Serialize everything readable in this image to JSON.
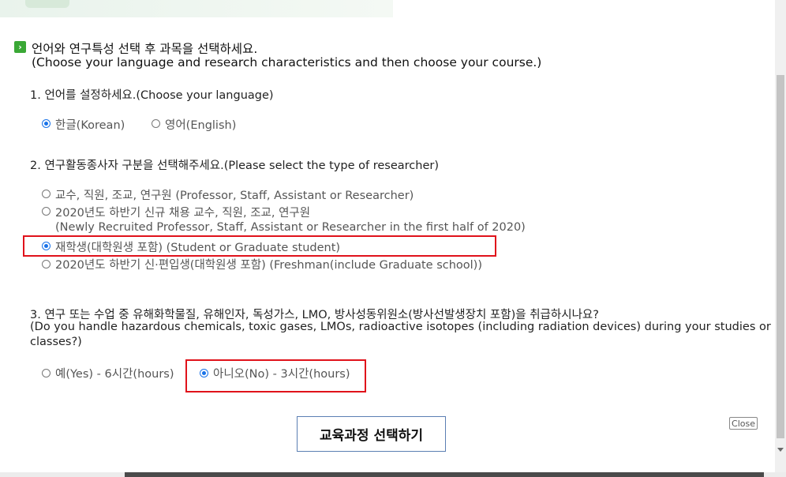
{
  "header": {
    "icon_glyph": "›",
    "line1": "언어와 연구특성 선택 후 과목을 선택하세요.",
    "line2": "(Choose your language and research characteristics and then choose your course.)"
  },
  "language": {
    "question": "1. 언어를 설정하세요.(Choose your language)",
    "options": [
      {
        "label": "한글(Korean)",
        "selected": true
      },
      {
        "label": "영어(English)",
        "selected": false
      }
    ]
  },
  "researcher": {
    "question": "2. 연구활동종사자 구분을 선택해주세요.(Please select the type of researcher)",
    "options": [
      {
        "label": "교수, 직원, 조교, 연구원 (Professor, Staff, Assistant or Researcher)",
        "selected": false
      },
      {
        "label": "2020년도 하반기 신규 채용 교수, 직원, 조교, 연구원",
        "label2": "(Newly Recruited Professor, Staff, Assistant or Researcher in the first half of 2020)",
        "selected": false
      },
      {
        "label": "재학생(대학원생 포함) (Student or Graduate student)",
        "selected": true
      },
      {
        "label": "2020년도 하반기 신·편입생(대학원생 포함) (Freshman(include Graduate school))",
        "selected": false
      }
    ]
  },
  "hazard": {
    "question_line1": "3. 연구 또는 수업 중 유해화학물질, 유해인자, 독성가스, LMO, 방사성동위원소(방사선발생장치 포함)을 취급하시나요?",
    "question_line2": "(Do you handle hazardous chemicals, toxic gases, LMOs, radioactive isotopes (including radiation devices) during your studies or",
    "question_line3": "classes?)",
    "options": [
      {
        "label": "예(Yes) - 6시간(hours)",
        "selected": false
      },
      {
        "label": "아니오(No) - 3시간(hours)",
        "selected": true
      }
    ]
  },
  "actions": {
    "submit_label": "교육과정 선택하기",
    "close_label": "Close"
  },
  "colors": {
    "accent_green": "#3aa835",
    "radio_blue": "#1a73e8",
    "highlight_red": "#e0121b"
  }
}
